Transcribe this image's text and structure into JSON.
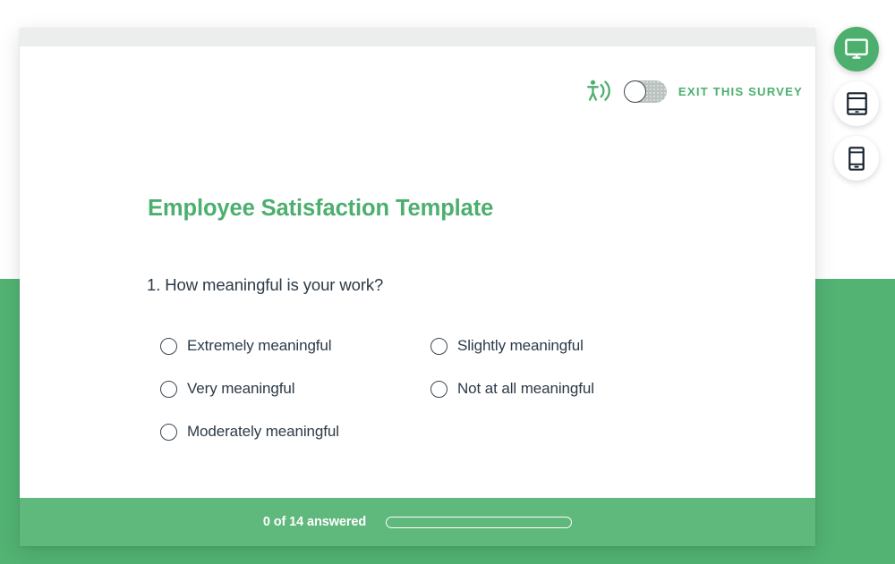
{
  "theme": {
    "brand_green": "#4caf6e",
    "page_green": "#52b373",
    "footer_green": "#5fb87c",
    "text_dark": "#2c3a47"
  },
  "header": {
    "accessibility_icon": "accessibility-audio-icon",
    "toggle": {
      "name": "accessibility-toggle",
      "state": "off"
    },
    "exit_label": "EXIT THIS SURVEY"
  },
  "survey": {
    "title": "Employee Satisfaction Template",
    "question": {
      "number": "1.",
      "text": "1. How meaningful is your work?",
      "options_left": [
        {
          "label": "Extremely meaningful",
          "selected": false
        },
        {
          "label": "Very meaningful",
          "selected": false
        },
        {
          "label": "Moderately meaningful",
          "selected": false
        }
      ],
      "options_right": [
        {
          "label": "Slightly meaningful",
          "selected": false
        },
        {
          "label": "Not at all meaningful",
          "selected": false
        }
      ]
    }
  },
  "footer": {
    "answered_text": "0 of 14 answered",
    "answered_count": 0,
    "total_questions": 14,
    "progress_percent": 0
  },
  "device_rail": [
    {
      "name": "desktop-preview-button",
      "icon": "desktop-monitor-icon",
      "active": true
    },
    {
      "name": "tablet-preview-button",
      "icon": "tablet-icon",
      "active": false
    },
    {
      "name": "mobile-preview-button",
      "icon": "mobile-phone-icon",
      "active": false
    }
  ]
}
